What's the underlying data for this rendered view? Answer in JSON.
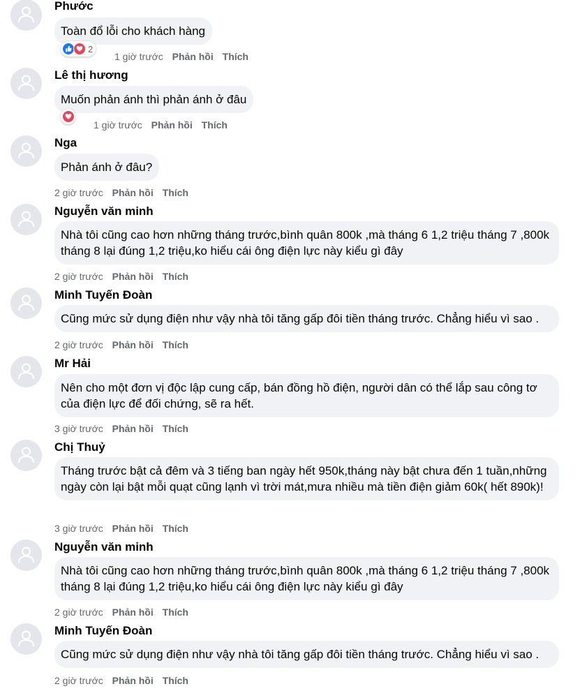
{
  "actions": {
    "reply": "Phản hồi",
    "like": "Thích"
  },
  "colors": {
    "like": "#1877f2",
    "love": "#f33e58",
    "bubble": "#f0f2f5",
    "meta": "#65676b"
  },
  "comments": [
    {
      "name": "Phước",
      "text": "Toàn đổ lỗi cho khách hàng",
      "time": "1 giờ trước",
      "reactions": [
        "like-icon",
        "heart-icon"
      ],
      "reaction_count": "2"
    },
    {
      "name": "Lê thị hương",
      "text": "Muốn phản ánh thì phản ánh ở đâu",
      "time": "1 giờ trước",
      "reactions": [
        "heart-icon"
      ]
    },
    {
      "name": "Nga",
      "text": "Phản ánh ở đâu?",
      "time": "2 giờ trước"
    },
    {
      "name": "Nguyễn văn minh",
      "text": "Nhà tôi cũng cao hơn những tháng trước,bình quân 800k ,mà tháng 6 1,2 triệu tháng 7 ,800k tháng 8 lại đúng 1,2 triệu,ko hiểu cái ông điện lực này kiểu gì đây",
      "time": "2 giờ trước"
    },
    {
      "name": "Minh Tuyến Đoàn",
      "text": "Cũng mức sử dụng điện như vậy nhà tôi tăng gấp đôi tiền tháng trước. Chẳng hiểu vì sao .",
      "time": "2 giờ trước"
    },
    {
      "name": "Mr Hải",
      "text": "Nên cho một đơn vị độc lập cung cấp, bán đồng hồ điện, người dân có thể lắp sau công tơ của điện lực để đối chứng, sẽ ra hết.",
      "time": "3 giờ trước"
    },
    {
      "name": "Chị Thuỷ",
      "text": "Tháng trước bật cả đêm và 3 tiếng ban ngày hết 950k,tháng này bật chưa đến 1 tuần,những ngày còn lại bật mỗi quạt cũng lạnh vì trời mát,mưa nhiều mà tiền điện giảm 60k( hết 890k)!",
      "time": "3 giờ trước"
    },
    {
      "name": "Nguyễn văn minh",
      "text": "Nhà tôi cũng cao hơn những tháng trước,bình quân 800k ,mà tháng 6 1,2 triệu tháng 7 ,800k tháng 8 lại đúng 1,2 triệu,ko hiểu cái ông điện lực này kiểu gì đây",
      "time": "2 giờ trước"
    },
    {
      "name": "Minh Tuyến Đoàn",
      "text": "Cũng mức sử dụng điện như vậy nhà tôi tăng gấp đôi tiền tháng trước. Chẳng hiểu vì sao .",
      "time": "2 giờ trước"
    }
  ]
}
